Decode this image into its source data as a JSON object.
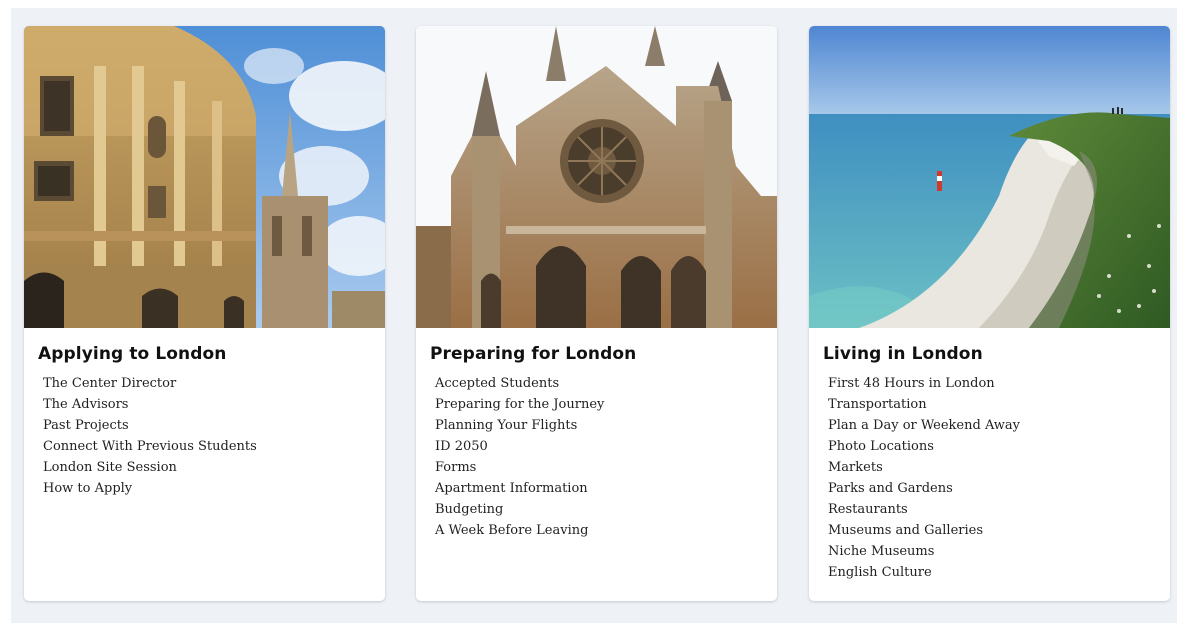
{
  "cards": [
    {
      "title": "Applying to London",
      "links": [
        "The Center Director",
        "The Advisors",
        "Past Projects",
        "Connect With Previous Students",
        "London Site Session",
        "How to Apply"
      ]
    },
    {
      "title": "Preparing for London",
      "links": [
        "Accepted Students",
        "Preparing for the Journey",
        "Planning Your Flights",
        "ID 2050",
        "Forms",
        "Apartment Information",
        "Budgeting",
        "A Week Before Leaving"
      ]
    },
    {
      "title": "Living in London",
      "links": [
        "First 48 Hours in London",
        "Transportation",
        "Plan a Day or Weekend Away",
        "Photo Locations",
        "Markets",
        "Parks and Gardens",
        "Restaurants",
        "Museums and Galleries",
        "Niche Museums",
        "English Culture"
      ]
    }
  ]
}
